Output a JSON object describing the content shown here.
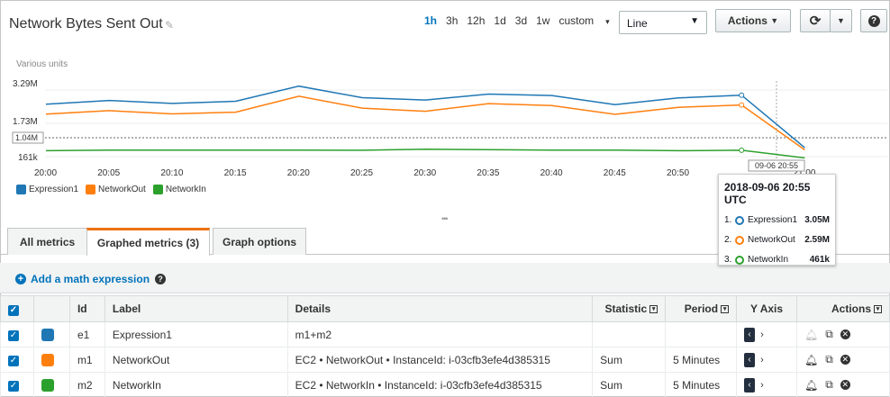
{
  "header": {
    "title": "Network Bytes Sent Out",
    "ranges": [
      "1h",
      "3h",
      "12h",
      "1d",
      "3d",
      "1w"
    ],
    "active_range": "1h",
    "custom_label": "custom",
    "chart_type": "Line",
    "actions_label": "Actions"
  },
  "chart_data": {
    "type": "line",
    "ylabel": "Various units",
    "y_ticks": [
      "3.29M",
      "1.73M",
      "1.04M",
      "161k"
    ],
    "x_ticks": [
      "20:00",
      "20:05",
      "20:10",
      "20:15",
      "20:20",
      "20:25",
      "20:30",
      "20:35",
      "20:40",
      "20:45",
      "20:50",
      "20:55",
      "21:00"
    ],
    "hover_x_label": "09-06 20:55",
    "series": [
      {
        "name": "Expression1",
        "color": "#1f77b4",
        "values": [
          2.62,
          2.8,
          2.66,
          2.76,
          3.47,
          2.93,
          2.82,
          3.1,
          3.03,
          2.6,
          2.92,
          3.05,
          0.58
        ]
      },
      {
        "name": "NetworkOut",
        "color": "#ff7f0e",
        "values": [
          2.16,
          2.32,
          2.17,
          2.25,
          3.0,
          2.44,
          2.29,
          2.65,
          2.56,
          2.15,
          2.48,
          2.59,
          0.48
        ]
      },
      {
        "name": "NetworkIn",
        "color": "#2ca02c",
        "values": [
          0.44,
          0.47,
          0.47,
          0.47,
          0.47,
          0.46,
          0.51,
          0.49,
          0.47,
          0.47,
          0.44,
          0.46,
          0.1
        ]
      }
    ]
  },
  "tooltip": {
    "title": "2018-09-06 20:55 UTC",
    "rows": [
      {
        "idx": "1.",
        "name": "Expression1",
        "value": "3.05M",
        "color": "#1f77b4"
      },
      {
        "idx": "2.",
        "name": "NetworkOut",
        "value": "2.59M",
        "color": "#ff7f0e"
      },
      {
        "idx": "3.",
        "name": "NetworkIn",
        "value": "461k",
        "color": "#2ca02c"
      }
    ]
  },
  "tabs": [
    {
      "label": "All metrics",
      "active": false
    },
    {
      "label": "Graphed metrics (3)",
      "active": true
    },
    {
      "label": "Graph options",
      "active": false
    }
  ],
  "math_link": "Add a math expression",
  "table": {
    "headers": {
      "id": "Id",
      "label": "Label",
      "details": "Details",
      "statistic": "Statistic",
      "period": "Period",
      "yaxis": "Y Axis",
      "actions": "Actions"
    },
    "rows": [
      {
        "color": "#1f77b4",
        "id": "e1",
        "label": "Expression1",
        "details": "m1+m2",
        "statistic": "",
        "period": ""
      },
      {
        "color": "#ff7f0e",
        "id": "m1",
        "label": "NetworkOut",
        "details": "EC2 • NetworkOut • InstanceId: i-03cfb3efe4d385315",
        "statistic": "Sum",
        "period": "5 Minutes"
      },
      {
        "color": "#2ca02c",
        "id": "m2",
        "label": "NetworkIn",
        "details": "EC2 • NetworkIn • InstanceId: i-03cfb3efe4d385315",
        "statistic": "Sum",
        "period": "5 Minutes"
      }
    ]
  }
}
